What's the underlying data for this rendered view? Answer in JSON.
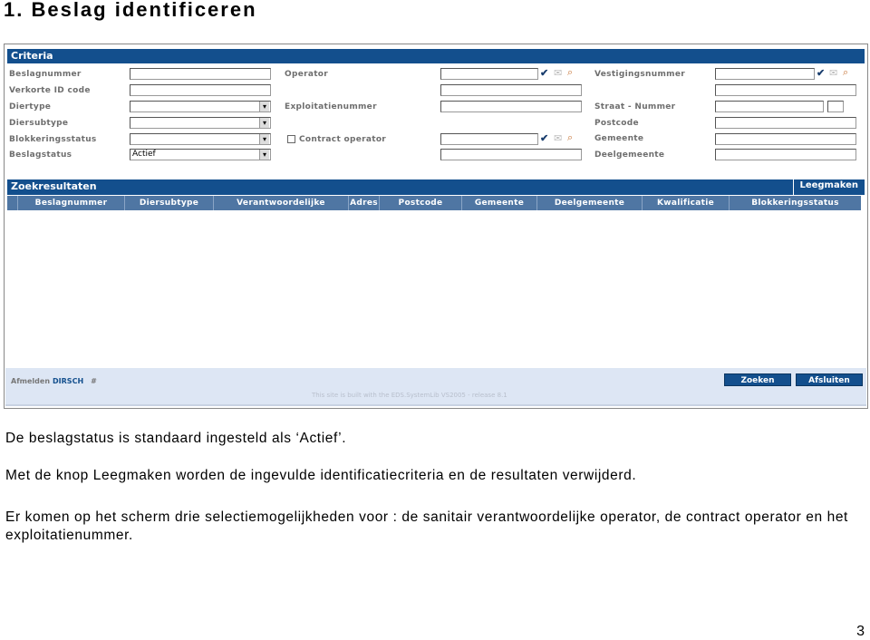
{
  "document": {
    "title": "1.  Beslag identificeren",
    "paragraphs": [
      "De beslagstatus is standaard ingesteld als ‘Actief’.",
      "Met de knop Leegmaken worden de ingevulde identificatiecriteria en de resultaten verwijderd.",
      "Er komen op het scherm drie selectiemogelijkheden voor : de sanitair verantwoordelijke operator, de contract operator en het exploitatienummer."
    ],
    "page_number": "3"
  },
  "criteria": {
    "header": "Criteria",
    "col1": {
      "beslagnummer": {
        "label": "Beslagnummer",
        "value": ""
      },
      "verkorte_id": {
        "label": "Verkorte ID code",
        "value": ""
      },
      "diertype": {
        "label": "Diertype",
        "value": ""
      },
      "diersubtype": {
        "label": "Diersubtype",
        "value": ""
      },
      "blokkeringsstatus": {
        "label": "Blokkeringsstatus",
        "value": ""
      },
      "beslagstatus": {
        "label": "Beslagstatus",
        "value": "Actief"
      }
    },
    "col2": {
      "operator": {
        "label": "Operator",
        "value": "",
        "value2": ""
      },
      "exploitatienummer": {
        "label": "Exploitatienummer",
        "value": ""
      },
      "contract_operator": {
        "label": "Contract operator",
        "checked": false,
        "value": "",
        "value2": ""
      }
    },
    "col3": {
      "vestigingsnummer": {
        "label": "Vestigingsnummer",
        "value": "",
        "value2": ""
      },
      "straat": {
        "label": "Straat - Nummer",
        "value": "",
        "nummer": ""
      },
      "postcode": {
        "label": "Postcode",
        "value": ""
      },
      "gemeente": {
        "label": "Gemeente",
        "value": ""
      },
      "deelgemeente": {
        "label": "Deelgemeente",
        "value": ""
      }
    },
    "icons": {
      "check": "✔",
      "memo": "✉",
      "search": "⌕"
    }
  },
  "results": {
    "header": "Zoekresultaten",
    "clear_button": "Leegmaken",
    "columns": [
      "",
      "Beslagnummer",
      "Diersubtype",
      "Verantwoordelijke",
      "Adres",
      "Postcode",
      "Gemeente",
      "Deelgemeente",
      "Kwalificatie",
      "Blokkeringsstatus"
    ]
  },
  "footer": {
    "logout": "Afmelden",
    "user": "DIRSCH",
    "hash": "#",
    "built_with": "This site is built with the EDS.SystemLib VS2005 - release 8.1",
    "search_button": "Zoeken",
    "close_button": "Afsluiten"
  }
}
